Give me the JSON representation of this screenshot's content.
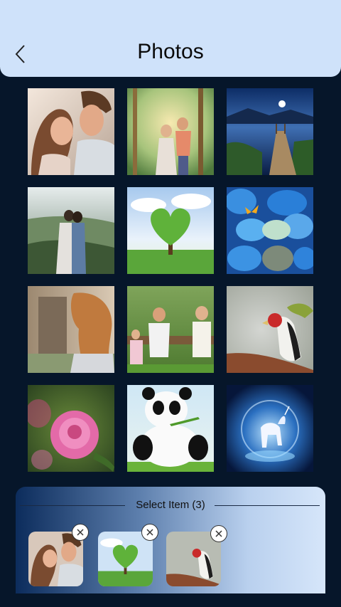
{
  "header": {
    "title": "Photos",
    "back_icon": "chevron-left-icon"
  },
  "photos": [
    {
      "name": "couple-kiss"
    },
    {
      "name": "couple-forest"
    },
    {
      "name": "lake-pier-night"
    },
    {
      "name": "couple-mountain-view"
    },
    {
      "name": "heart-tree"
    },
    {
      "name": "blue-pebbles-butterfly"
    },
    {
      "name": "woman-curly-hair"
    },
    {
      "name": "family-bench"
    },
    {
      "name": "bird-on-branch"
    },
    {
      "name": "pink-rose"
    },
    {
      "name": "panda-cartoon"
    },
    {
      "name": "unicorn-moon"
    }
  ],
  "selection": {
    "title": "Select Item (3)",
    "items": [
      {
        "photo": "couple-kiss"
      },
      {
        "photo": "heart-tree"
      },
      {
        "photo": "bird-on-branch"
      }
    ],
    "remove_icon": "close-circle-icon"
  },
  "colors": {
    "header_bg": "#cfe2fa",
    "page_bg": "#06162a",
    "panel_gradient_start": "#0c2c5c",
    "panel_gradient_end": "#d6e6fa"
  }
}
